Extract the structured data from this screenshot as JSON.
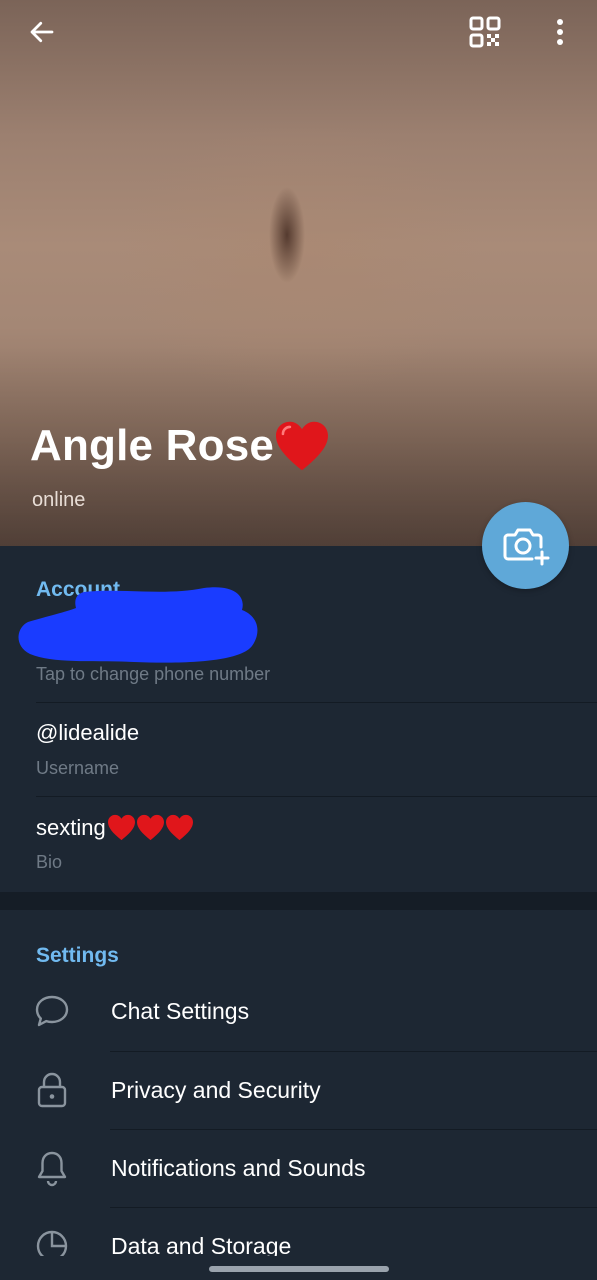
{
  "header": {
    "back_icon": "arrow-left-icon",
    "qr_icon": "qr-code-icon",
    "more_icon": "more-vertical-icon"
  },
  "profile": {
    "name": "Angle Rose",
    "name_emoji": "heart-icon",
    "status": "online",
    "camera_icon": "camera-add-icon"
  },
  "account": {
    "title": "Account",
    "phone_hint": "Tap to change phone number",
    "username": "@lidealide",
    "username_label": "Username",
    "bio": "sexting",
    "bio_emoji_count": 3,
    "bio_label": "Bio"
  },
  "settings": {
    "title": "Settings",
    "items": [
      {
        "label": "Chat Settings",
        "icon": "chat-bubble-icon"
      },
      {
        "label": "Privacy and Security",
        "icon": "lock-icon"
      },
      {
        "label": "Notifications and Sounds",
        "icon": "bell-icon"
      },
      {
        "label": "Data and Storage",
        "icon": "clock-pie-icon"
      }
    ]
  },
  "colors": {
    "accent": "#71baf0",
    "fab": "#5fa8d8",
    "background": "#1d2733",
    "redaction": "#1a3cff"
  }
}
